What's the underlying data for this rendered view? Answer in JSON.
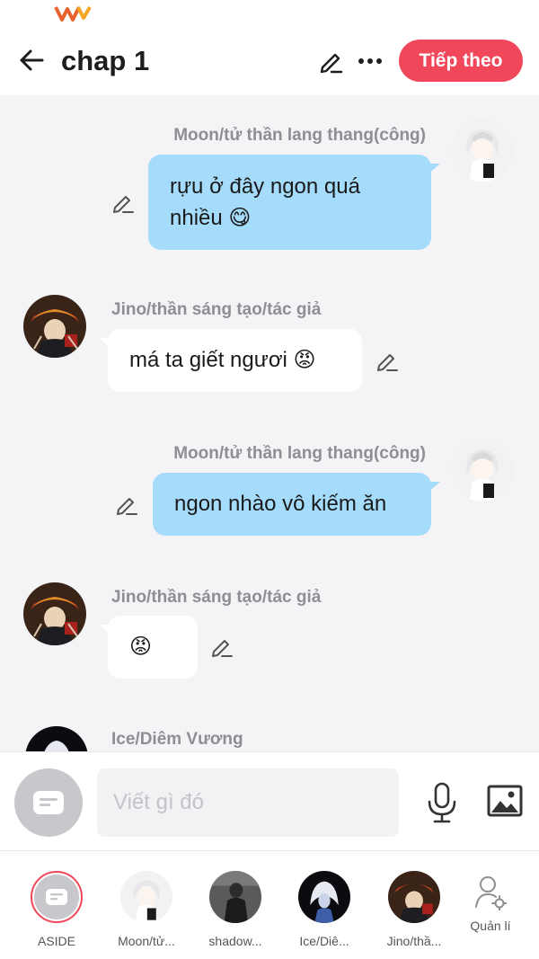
{
  "header": {
    "title": "chap 1",
    "next_label": "Tiếp theo"
  },
  "messages": [
    {
      "sender": "Moon/tử thần lang thang(công)",
      "text_line1": "rựu ở đây ngon quá",
      "text_line2": "nhiều 😋",
      "side": "right"
    },
    {
      "sender": "Jino/thần sáng tạo/tác giả",
      "text": "má ta giết ngươi 😡",
      "side": "left"
    },
    {
      "sender": "Moon/tử thần lang thang(công)",
      "text": "ngon nhào vô kiếm ăn",
      "side": "right"
    },
    {
      "sender": "Jino/thần sáng tạo/tác giả",
      "text": "😡",
      "side": "left"
    },
    {
      "sender": "Ice/Diêm Vương",
      "side": "left"
    }
  ],
  "composer": {
    "placeholder": "Viết gì đó"
  },
  "characters": [
    {
      "label": "ASIDE"
    },
    {
      "label": "Moon/tử..."
    },
    {
      "label": "shadow..."
    },
    {
      "label": "Ice/Diê..."
    },
    {
      "label": "Jino/thầ..."
    },
    {
      "label": "Quản lí"
    }
  ],
  "colors": {
    "accent": "#f0485a",
    "bubble_self": "#a6dcfb",
    "bubble_other": "#ffffff",
    "background": "#f4f4f6"
  }
}
